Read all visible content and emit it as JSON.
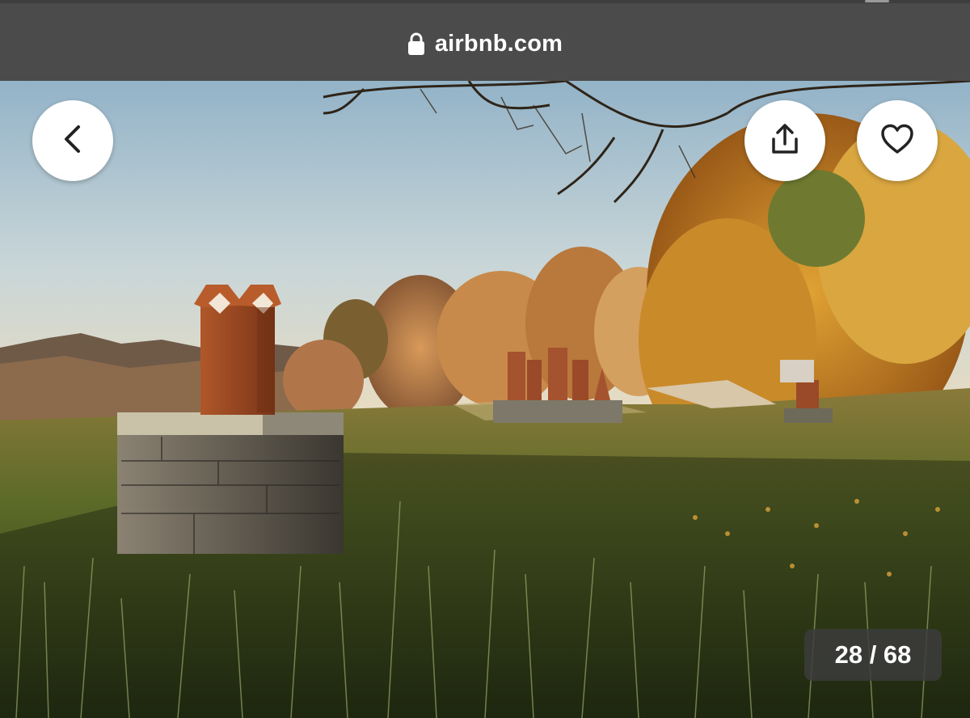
{
  "browser": {
    "url": "airbnb.com",
    "lock_icon": "lock-icon"
  },
  "viewer": {
    "back_icon": "chevron-left-icon",
    "share_icon": "share-icon",
    "save_icon": "heart-icon",
    "counter": "28 / 68",
    "photo_subject": "outdoor-photo"
  },
  "colors": {
    "address_bar": "#4b4b4b",
    "button_bg": "#ffffff",
    "icon": "#222222",
    "counter_bg": "#3c3c3c"
  }
}
